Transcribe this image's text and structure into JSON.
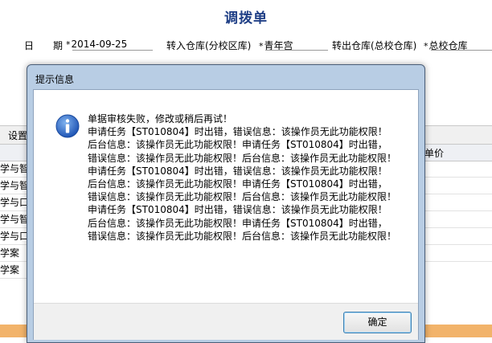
{
  "form": {
    "title": "调拨单",
    "date_label_1": "日",
    "date_label_2": "期",
    "date_value": "2014-09-25",
    "in_warehouse_label": "转入仓库(分校区库)",
    "in_warehouse_value": "青年宫",
    "out_warehouse_label": "转出仓库(总校仓库)",
    "out_warehouse_value": "总校仓库",
    "required_mark": "*"
  },
  "toolbar": {
    "settings_label": "设置"
  },
  "grid": {
    "unit_price_header": "单价",
    "rows": [
      "学与智",
      "学与智",
      "学与口",
      "学与智",
      "学与口",
      "学案",
      "学案"
    ]
  },
  "dialog": {
    "title": "提示信息",
    "icon": "info-icon",
    "message_line1": "单据审核失败，修改或稍后再试！",
    "message_body": "申请任务【ST010804】时出错，错误信息：该操作员无此功能权限！后台信息：该操作员无此功能权限！申请任务【ST010804】时出错，错误信息：该操作员无此功能权限！后台信息：该操作员无此功能权限！申请任务【ST010804】时出错，错误信息：该操作员无此功能权限！后台信息：该操作员无此功能权限！申请任务【ST010804】时出错，错误信息：该操作员无此功能权限！后台信息：该操作员无此功能权限！申请任务【ST010804】时出错，错误信息：该操作员无此功能权限！后台信息：该操作员无此功能权限！申请任务【ST010804】时出错，错误信息：该操作员无此功能权限！后台信息：该操作员无此功能权限！",
    "ok_label": "确定"
  }
}
